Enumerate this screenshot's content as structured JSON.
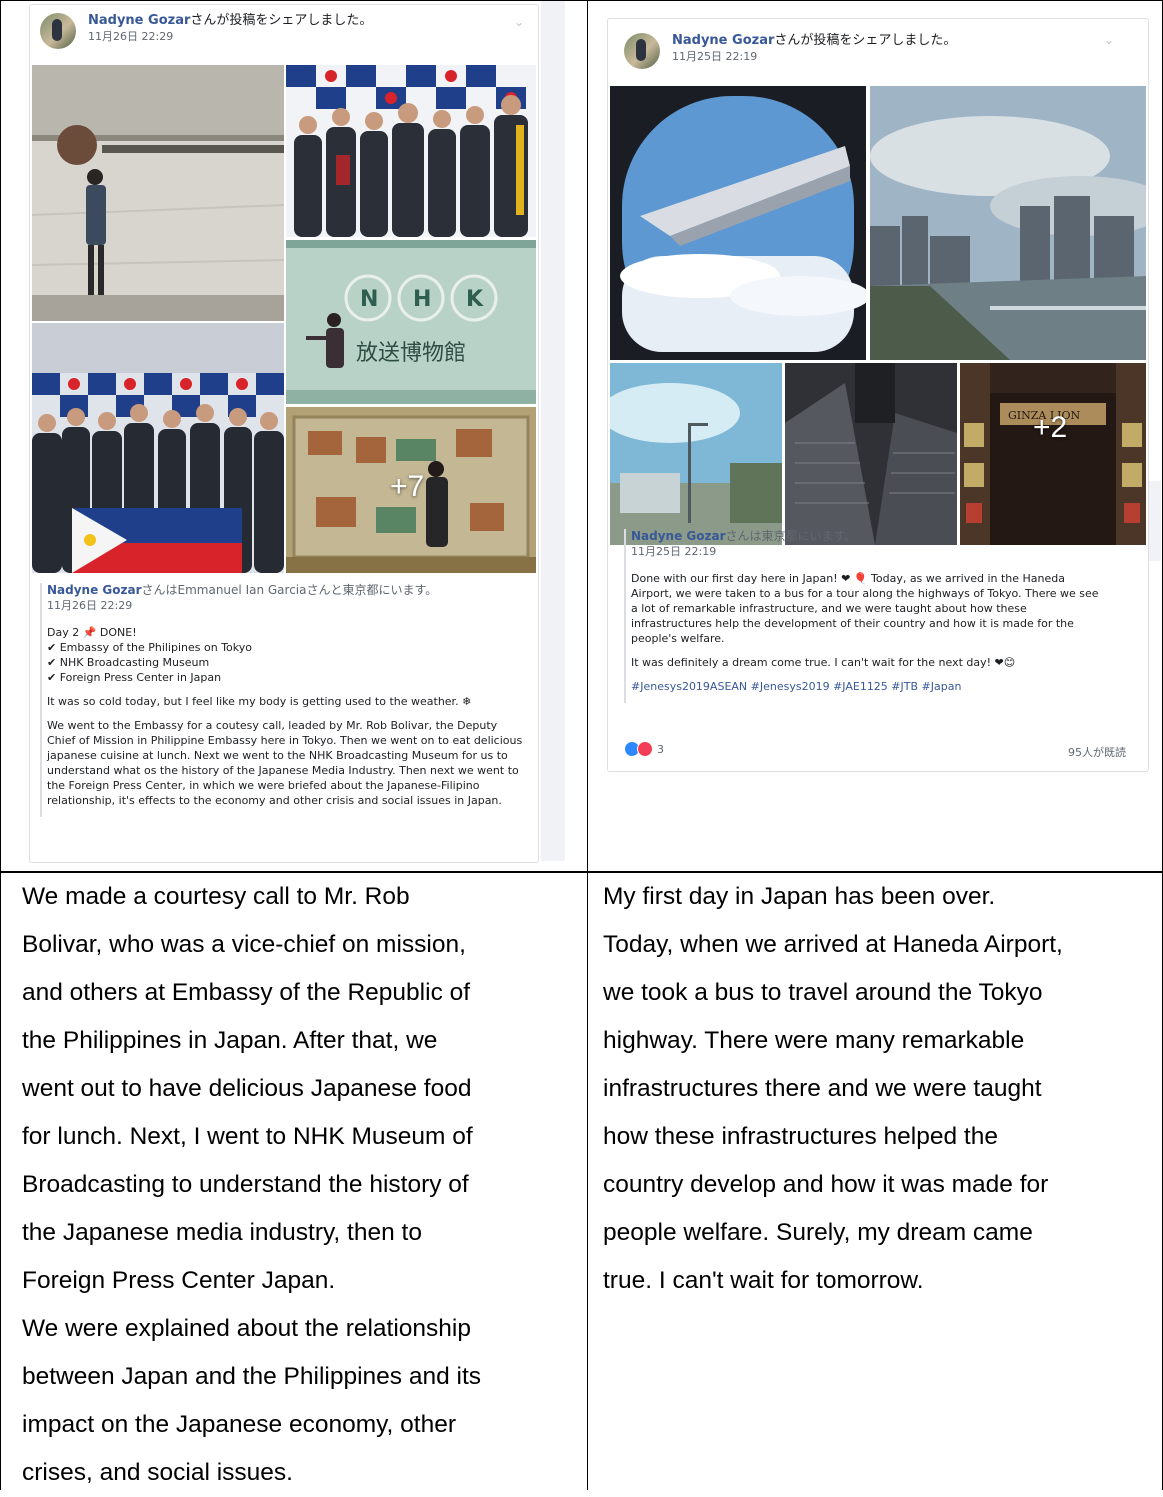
{
  "left_post": {
    "author": "Nadyne Gozar",
    "shared_suffix": "さんが投稿をシェアしました。",
    "timestamp": "11月26日 22:29",
    "more_photos": "+7",
    "shared_author": "Nadyne Gozar",
    "shared_with_text": "さんはEmmanuel Ian Garciaさんと東京都にいます。",
    "shared_timestamp": "11月26日 22:29",
    "day_line": "Day 2 📌 DONE!",
    "checklist": [
      "✔ Embassy of the Philipines on Tokyo",
      "✔ NHK Broadcasting Museum",
      "✔ Foreign Press Center in Japan"
    ],
    "cold_line": "It was so cold today, but I feel like my body is getting used to the weather. ❄",
    "body": "We went to the Embassy for a coutesy call, leaded by Mr. Rob Bolivar, the Deputy Chief of Mission in Philippine Embassy here in Tokyo. Then we went on to eat delicious japanese cuisine at lunch. Next we went to the NHK Broadcasting Museum for us to understand what os the history of the Japanese Media Industry. Then next we went to the Foreign Press Center, in which we were briefed about the Japanese-Filipino relationship, it's effects to the economy and other crisis and social issues in Japan.",
    "nhk_sign": "放送博物館"
  },
  "right_post": {
    "author": "Nadyne Gozar",
    "shared_suffix": "さんが投稿をシェアしました。",
    "timestamp": "11月25日 22:19",
    "more_photos": "+2",
    "store_sign": "GINZA LION",
    "shared_author": "Nadyne Gozar",
    "shared_with_text": "さんは東京都にいます。",
    "shared_timestamp": "11月25日 22:19",
    "body1": "Done with our first day here in Japan! ❤ 🎈 Today, as we arrived in the Haneda Airport, we were taken to a bus for a tour along the highways of Tokyo. There we see a lot of remarkable infrastructure, and we were taught about how these infrastructures help the development of their country and how it is made for the people's welfare.",
    "body2": "It was definitely a dream come true. I can't wait for the next day! ❤😊",
    "hashtags": "#Jenesys2019ASEAN #Jenesys2019 #JAE1125 #JTB #Japan",
    "reaction_count": "3",
    "seen_text": "95人が既読"
  },
  "translations": {
    "left": [
      "We made a courtesy call to Mr. Rob",
      "Bolivar, who was a vice-chief on mission,",
      "and others at Embassy of the Republic of",
      "the Philippines in Japan. After that, we",
      "went out to have delicious Japanese food",
      "for lunch. Next, I went to NHK Museum of",
      "Broadcasting to understand the history of",
      "the Japanese media industry, then to",
      "Foreign Press Center Japan.",
      "We were explained about the relationship",
      "between Japan and the Philippines and its",
      "impact on the Japanese economy, other",
      "crises, and social issues."
    ],
    "right": [
      "My first day in Japan has been over.",
      "Today, when we arrived at Haneda Airport,",
      "we took a bus to travel around the Tokyo",
      "highway. There were many remarkable",
      "infrastructures there and we were taught",
      "how these infrastructures helped the",
      "country develop and how it was made for",
      "people welfare. Surely, my dream came",
      "true. I can't wait for tomorrow."
    ]
  }
}
